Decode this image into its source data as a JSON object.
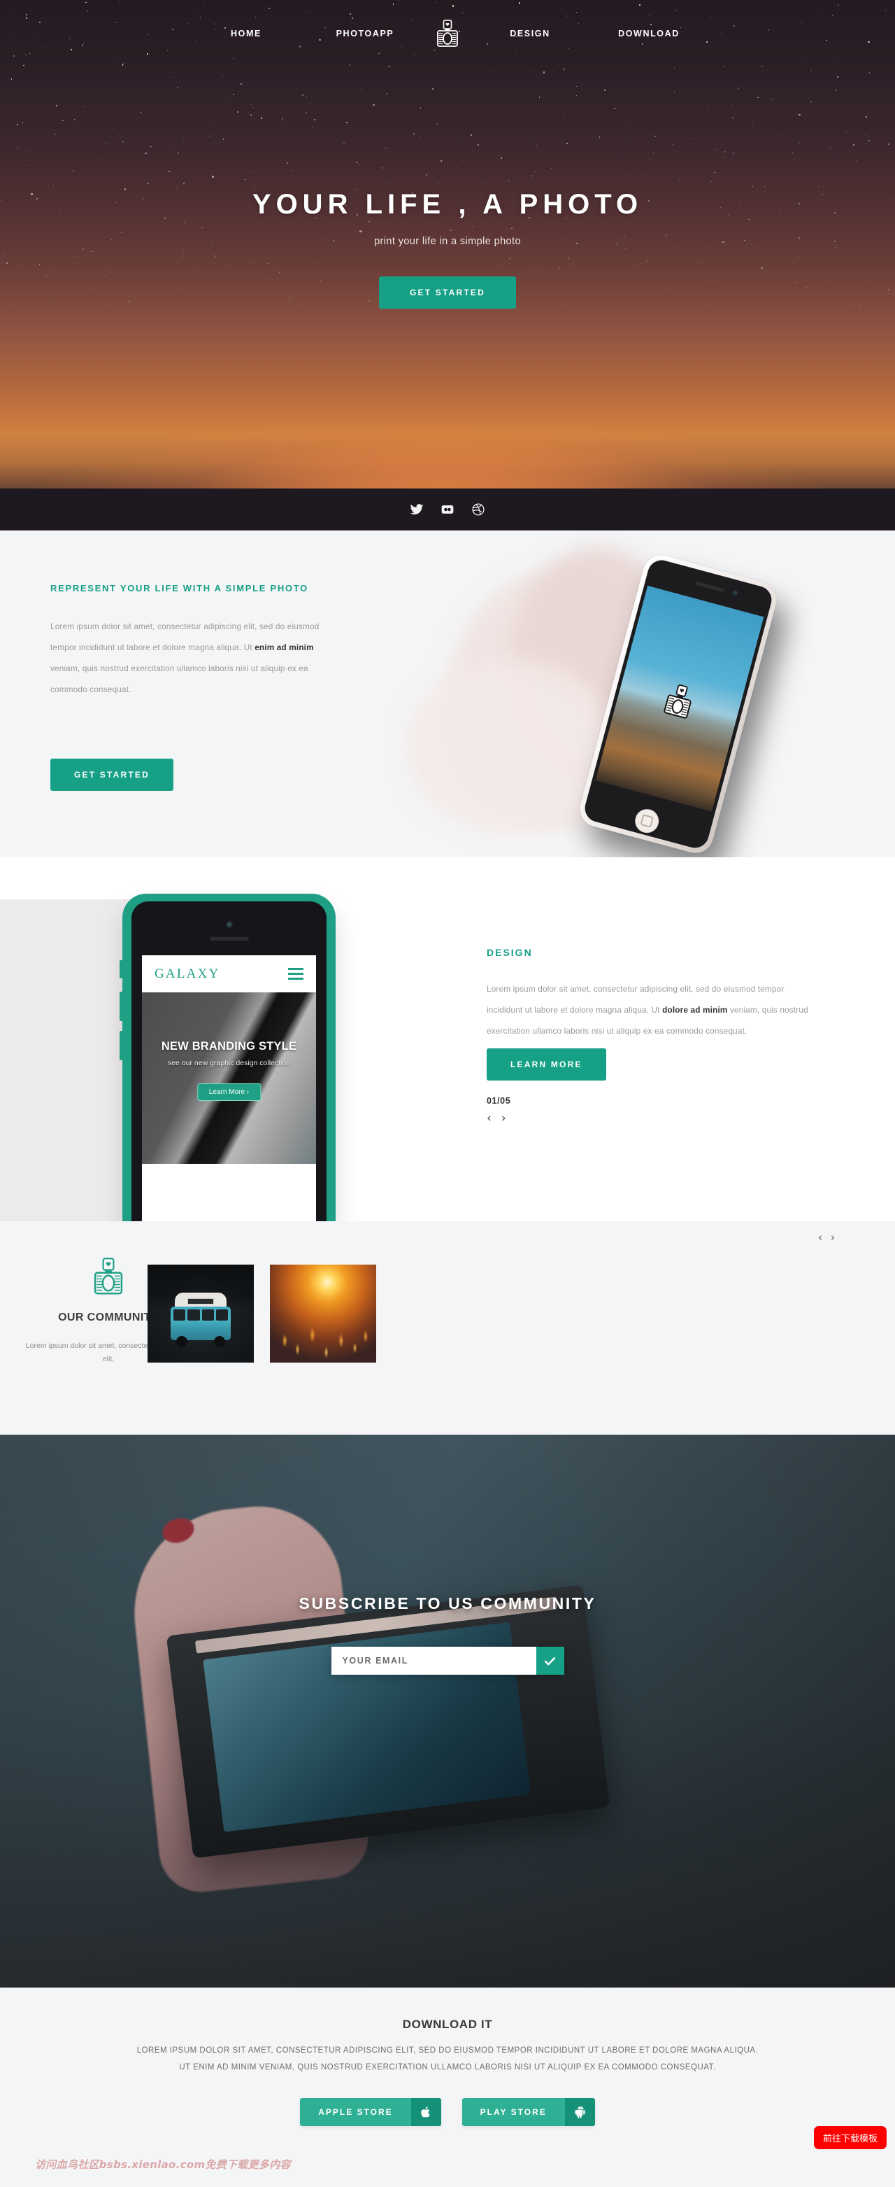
{
  "nav": {
    "items": [
      {
        "label": "HOME"
      },
      {
        "label": "PHOTOAPP"
      },
      {
        "label": "DESIGN"
      },
      {
        "label": "DOWNLOAD"
      }
    ],
    "logo_icon": "camera-icon"
  },
  "hero": {
    "title": "YOUR LIFE , A PHOTO",
    "subtitle": "print your life in a simple photo",
    "cta": "GET STARTED",
    "socials": [
      {
        "name": "twitter-icon"
      },
      {
        "name": "flickr-icon"
      },
      {
        "name": "dribbble-icon"
      }
    ]
  },
  "represent": {
    "kicker": "REPRESENT YOUR LIFE WITH A SIMPLE PHOTO",
    "copy_1": "Lorem ipsum dolor sit amet, consectetur adipiscing elit, sed do eiusmod tempor incididunt ut labore et dolore magna aliqua. Ut ",
    "copy_bold": "enim ad minim",
    "copy_2": " veniam, quis nostrud exercitation ullamco laboris nisi ut aliquip ex ea commodo consequat.",
    "cta": "GET STARTED"
  },
  "design": {
    "kicker": "DESIGN",
    "copy_1": "Lorem ipsum dolor sit amet, consectetur adipiscing elit, sed do eiusmod tempor incididunt ut labore et dolore magna aliqua. Ut ",
    "copy_bold": "dolore ad minim",
    "copy_2": " veniam, quis nostrud exercitation ullamco laboris nisi ut aliquip ex ea commodo consequat.",
    "cta": "LEARN MORE",
    "counter": "01/05",
    "prev": "‹",
    "next": "›",
    "phone": {
      "brand": "GALAXY",
      "slide_title": "NEW BRANDING STYLE",
      "slide_sub": "see our new graphic design collection",
      "slide_cta": "Learn More  ›"
    }
  },
  "community": {
    "title": "OUR COMMUNITY",
    "copy": "Lorem ipsum dolor sit amet, consectetur adipiscing elit,",
    "icon": "camera-icon",
    "prev": "‹",
    "next": "›",
    "tiles": [
      {
        "alt": "blue-van-photo"
      },
      {
        "alt": "sunset-field-photo"
      }
    ]
  },
  "subscribe": {
    "title": "SUBSCRIBE TO US COMMUNITY",
    "email_value": "",
    "email_placeholder": "YOUR EMAIL",
    "submit_icon": "check-icon"
  },
  "download": {
    "title": "DOWNLOAD IT",
    "copy": "LOREM IPSUM DOLOR SIT AMET, CONSECTETUR ADIPISCING ELIT, SED DO EIUSMOD TEMPOR INCIDIDUNT UT LABORE ET DOLORE MAGNA ALIQUA. UT ENIM AD MINIM VENIAM, QUIS NOSTRUD EXERCITATION ULLAMCO LABORIS NISI UT ALIQUIP EX EA COMMODO CONSEQUAT.",
    "stores": [
      {
        "label": "APPLE STORE",
        "icon": "apple-icon"
      },
      {
        "label": "PLAY STORE",
        "icon": "android-icon"
      }
    ]
  },
  "footer": {
    "watermark": "访问血鸟社区bsbs.xienlao.com免费下载更多内容",
    "badge": "前往下载模板"
  },
  "colors": {
    "accent": "#16a085",
    "accent_light": "#2fb094",
    "accent_dark": "#149178",
    "badge_red": "#fc0000",
    "section_gray": "#f4f5f7"
  }
}
